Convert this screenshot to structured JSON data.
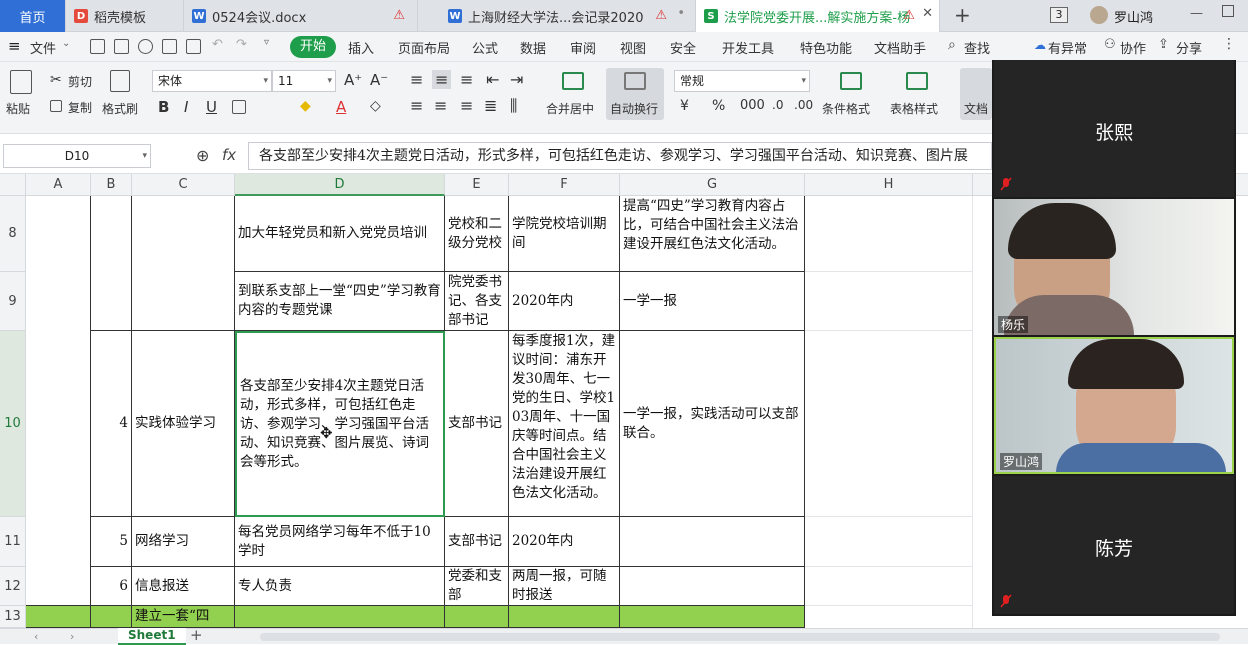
{
  "tabs": [
    {
      "label": "首页"
    },
    {
      "label": "稻壳模板"
    },
    {
      "label": "0524会议.docx"
    },
    {
      "label": "上海财经大学法...会记录2020"
    },
    {
      "label": "法学院党委开展...解实施方案-杨"
    }
  ],
  "tabbar": {
    "window_count": "3",
    "user_name": "罗山鸿"
  },
  "menu": {
    "file": "文件",
    "items": [
      "开始",
      "插入",
      "页面布局",
      "公式",
      "数据",
      "审阅",
      "视图",
      "安全",
      "开发工具",
      "特色功能",
      "文档助手"
    ],
    "search": "查找",
    "anomaly": "有异常",
    "collab": "协作",
    "share": "分享"
  },
  "ribbon": {
    "paste": "粘贴",
    "cut": "剪切",
    "copy": "复制",
    "format_painter": "格式刷",
    "font_name": "宋体",
    "font_size": "11",
    "merge_center": "合并居中",
    "auto_wrap": "自动换行",
    "number_format": "常规",
    "cond_format": "条件格式",
    "table_style": "表格样式",
    "doc": "文档"
  },
  "formula": {
    "cell_ref": "D10",
    "fx": "fx",
    "content": "各支部至少安排4次主题党日活动，形式多样，可包括红色走访、参观学习、学习强国平台活动、知识竞赛、图片展"
  },
  "columns": [
    "A",
    "B",
    "C",
    "D",
    "E",
    "F",
    "G",
    "H"
  ],
  "rows": [
    {
      "num": "8",
      "b": "",
      "c": "",
      "d": "加大年轻党员和新入党党员培训",
      "e": "党校和二级分党校",
      "f": "学院党校培训期间",
      "g": "提高“四史”学习教育内容占比，可结合中国社会主义法治建设开展红色法文化活动。"
    },
    {
      "num": "9",
      "b": "",
      "c": "",
      "d": "到联系支部上一堂“四史”学习教育内容的专题党课",
      "e": "院党委书记、各支部书记",
      "f": "2020年内",
      "g": "一学一报"
    },
    {
      "num": "10",
      "b": "4",
      "c": "实践体验学习",
      "d": "各支部至少安排4次主题党日活动，形式多样，可包括红色走访、参观学习、学习强国平台活动、知识竞赛、图片展览、诗词会等形式。",
      "e": "支部书记",
      "f": "每季度报1次，建议时间：浦东开发30周年、七一党的生日、学校103周年、十一国庆等时间点。结合中国社会主义法治建设开展红色法文化活动。",
      "g": "一学一报，实践活动可以支部联合。"
    },
    {
      "num": "11",
      "b": "5",
      "c": "网络学习",
      "d": "每名党员网络学习每年不低于10学时",
      "e": "支部书记",
      "f": "2020年内",
      "g": ""
    },
    {
      "num": "12",
      "b": "6",
      "c": "信息报送",
      "d": "专人负责",
      "e": "党委和支部",
      "f": "两周一报，可随时报送",
      "g": ""
    },
    {
      "num": "13",
      "b": "",
      "c": "建立一套“四",
      "d": "",
      "e": "",
      "f": "",
      "g": ""
    }
  ],
  "sheet": {
    "name": "Sheet1",
    "add": "+"
  },
  "video": {
    "participants": [
      {
        "name": "张熙",
        "label": ""
      },
      {
        "name": "",
        "label": "杨乐"
      },
      {
        "name": "",
        "label": "罗山鸿"
      },
      {
        "name": "陈芳",
        "label": ""
      }
    ]
  }
}
